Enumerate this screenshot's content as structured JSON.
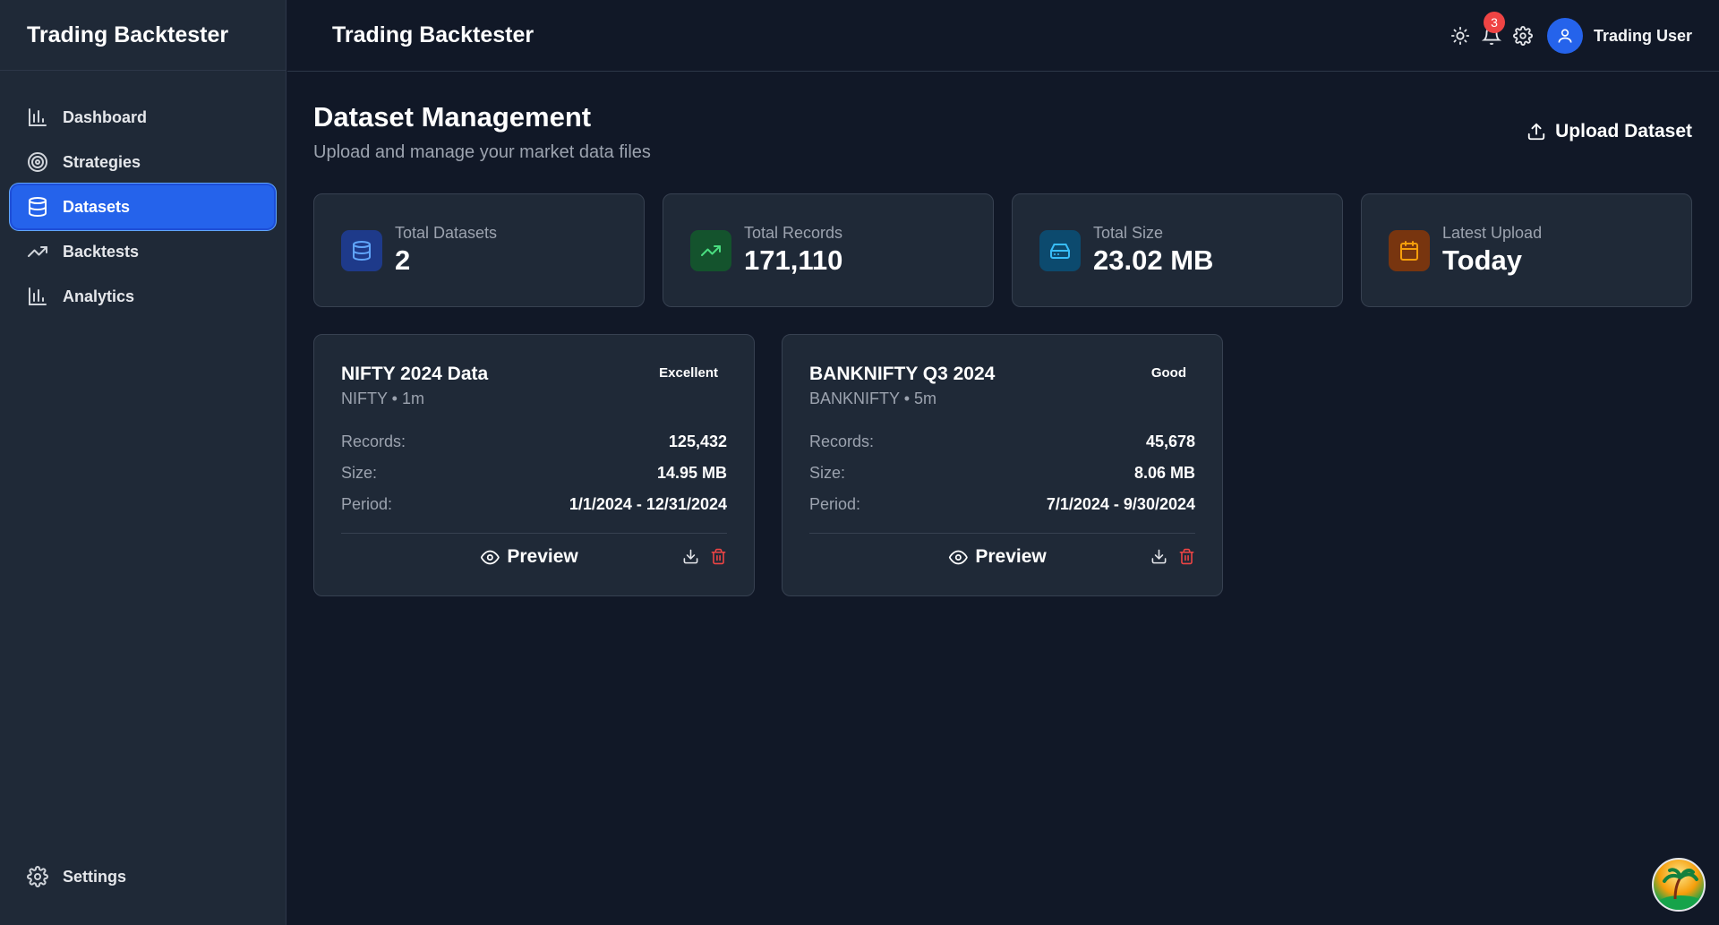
{
  "app": {
    "brand": "Trading Backtester"
  },
  "sidebar": {
    "items": [
      {
        "label": "Dashboard",
        "icon": "bar-chart-icon"
      },
      {
        "label": "Strategies",
        "icon": "target-icon"
      },
      {
        "label": "Datasets",
        "icon": "database-icon",
        "active": true
      },
      {
        "label": "Backtests",
        "icon": "trending-up-icon"
      },
      {
        "label": "Analytics",
        "icon": "bar-chart-icon"
      }
    ],
    "settings_label": "Settings"
  },
  "header": {
    "title": "Trading Backtester",
    "notifications_count": "3",
    "user_name": "Trading User"
  },
  "page": {
    "title": "Dataset Management",
    "subtitle": "Upload and manage your market data files",
    "upload_label": "Upload Dataset"
  },
  "stats": [
    {
      "label": "Total Datasets",
      "value": "2",
      "color": "#60a5fa",
      "bg": "#1e3a8a"
    },
    {
      "label": "Total Records",
      "value": "171,110",
      "color": "#4ade80",
      "bg": "#14532d"
    },
    {
      "label": "Total Size",
      "value": "23.02 MB",
      "color": "#38bdf8",
      "bg": "#0c4a6e"
    },
    {
      "label": "Latest Upload",
      "value": "Today",
      "color": "#f59e0b",
      "bg": "#78350f"
    }
  ],
  "datasets": [
    {
      "name": "NIFTY 2024 Data",
      "meta": "NIFTY • 1m",
      "badge": "Excellent",
      "records_label": "Records:",
      "records": "125,432",
      "size_label": "Size:",
      "size": "14.95 MB",
      "period_label": "Period:",
      "period": "1/1/2024 - 12/31/2024",
      "preview_label": "Preview"
    },
    {
      "name": "BANKNIFTY Q3 2024",
      "meta": "BANKNIFTY • 5m",
      "badge": "Good",
      "records_label": "Records:",
      "records": "45,678",
      "size_label": "Size:",
      "size": "8.06 MB",
      "period_label": "Period:",
      "period": "7/1/2024 - 9/30/2024",
      "preview_label": "Preview"
    }
  ],
  "colors": {
    "accent": "#2563eb",
    "danger": "#ef4444"
  }
}
